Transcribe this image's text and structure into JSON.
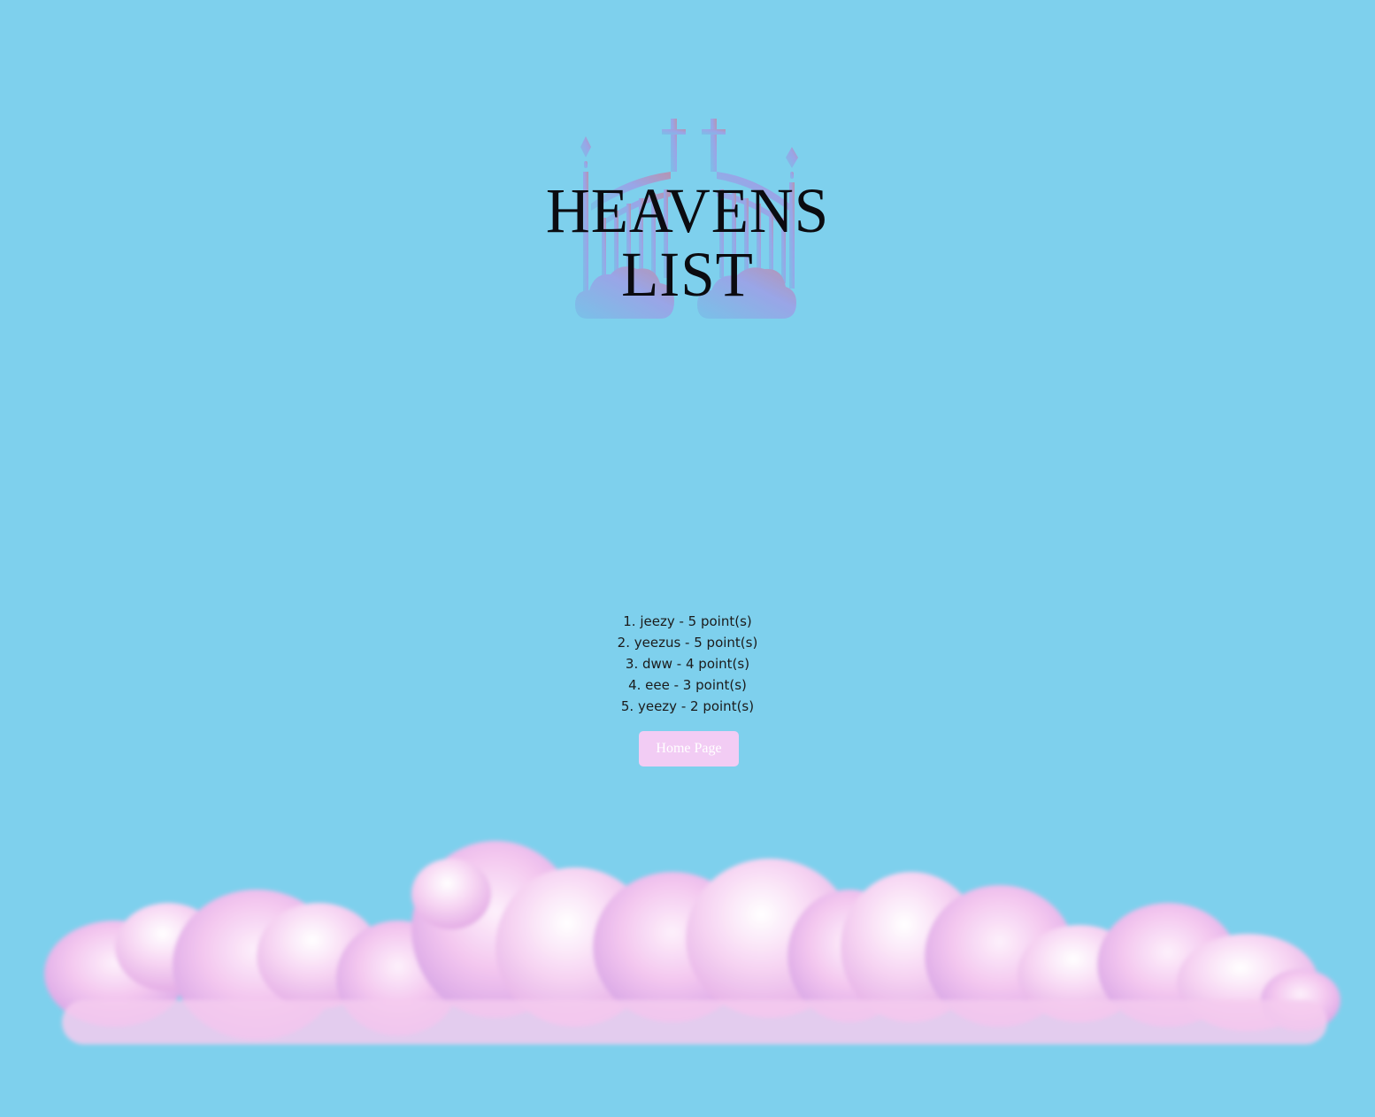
{
  "app": {
    "title": "HEAVENS LIST"
  },
  "leaderboard": {
    "entries": [
      {
        "text": "1. jeezy - 5 point(s)"
      },
      {
        "text": "2. yeezus - 5 point(s)"
      },
      {
        "text": "3. dww - 4 point(s)"
      },
      {
        "text": "4. eee - 3 point(s)"
      },
      {
        "text": "5. yeezy - 2 point(s)"
      }
    ]
  },
  "nav": {
    "home_label": "Home Page"
  },
  "icons": {
    "logo": "heaven-gates-icon",
    "decoration": "pink-clouds"
  },
  "colors": {
    "background": "#7ed0ed",
    "button": "#f2ccf4",
    "title": "#0b0b10",
    "gate_start": "#7fb6f2",
    "gate_end": "#b98fc9",
    "cloud": "#f6c9ef"
  }
}
